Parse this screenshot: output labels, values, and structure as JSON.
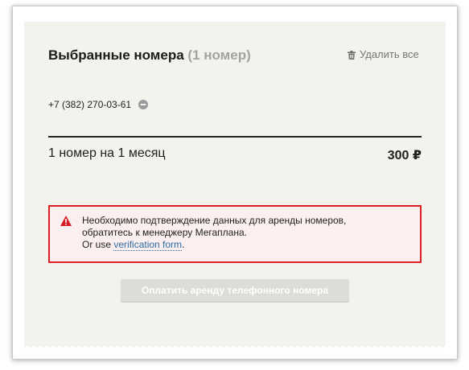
{
  "colors": {
    "panel_bg": "#f3f2ed",
    "alert_border": "#dd1e25",
    "alert_bg": "#fbefef",
    "link": "#2c6ea6",
    "muted": "#a3a3a3"
  },
  "header": {
    "title": "Выбранные номера",
    "count": "(1 номер)",
    "delete_all_label": "Удалить все",
    "delete_icon": "trash-icon"
  },
  "numbers": [
    {
      "phone": "+7 (382) 270-03-61",
      "remove_icon": "minus-circle-icon"
    }
  ],
  "summary": {
    "label": "1 номер на 1 месяц",
    "total": "300 ₽"
  },
  "alert": {
    "icon": "warning-icon",
    "line1": "Необходимо подтверждение данных для аренды номеров,",
    "line2": "обратитесь к менеджеру Мегаплана.",
    "line3_prefix": "Or use ",
    "link_text": "verification form",
    "line3_suffix": "."
  },
  "pay_button": {
    "label": "Оплатить аренду телефонного номера",
    "disabled": true
  }
}
